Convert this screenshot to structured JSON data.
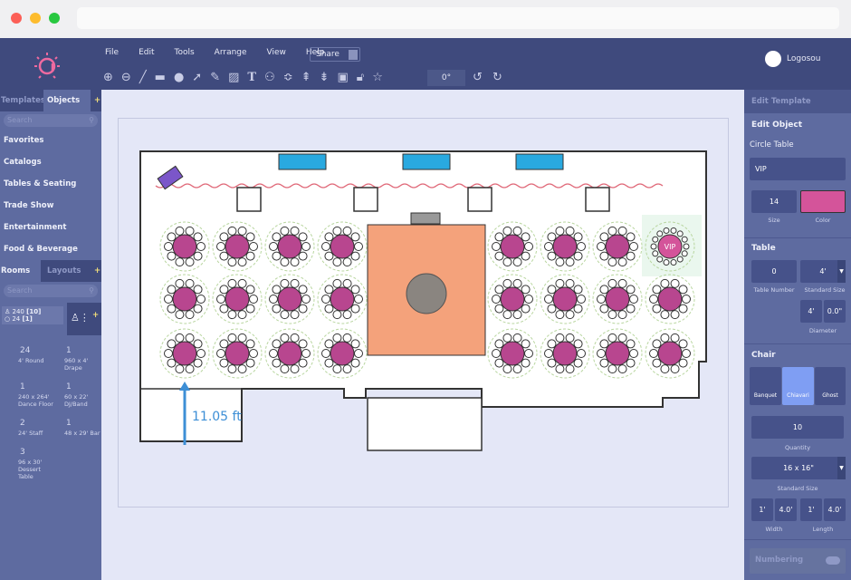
{
  "menu": {
    "items": [
      "File",
      "Edit",
      "Tools",
      "Arrange",
      "View",
      "Help"
    ],
    "share": "Share"
  },
  "toolbar": {
    "angle": "0°",
    "text_tool": "T"
  },
  "user": {
    "name": "Logosou"
  },
  "left": {
    "tabs": [
      "Templates",
      "Objects"
    ],
    "search_placeholder": "Search",
    "categories": [
      "Favorites",
      "Catalogs",
      "Tables & Seating",
      "Trade Show",
      "Entertainment",
      "Food & Beverage"
    ],
    "room_tabs": [
      "Rooms",
      "Layouts"
    ],
    "room_search_placeholder": "Search",
    "capacity": {
      "seats": "240",
      "seats_sub": "[10]",
      "tables": "24",
      "tables_sub": "[1]"
    },
    "stats": [
      {
        "count": "24",
        "label": "4' Round"
      },
      {
        "count": "1",
        "label": "960 x 4' Drape"
      },
      {
        "count": "1",
        "label": "240 x 264' Dance Floor"
      },
      {
        "count": "1",
        "label": "60 x 22' DJ/Band"
      },
      {
        "count": "2",
        "label": "24' Staff"
      },
      {
        "count": "1",
        "label": "48 x 29' Bar"
      },
      {
        "count": "3",
        "label": "96 x 30' Dessert Table"
      }
    ]
  },
  "plan": {
    "measurement": "11.05 ft",
    "vip_label": "VIP",
    "table_color": "#b8468f",
    "dance_floor_color": "#f4a27b",
    "stage_color": "#29a9e0"
  },
  "right": {
    "edit_template": "Edit Template",
    "edit_object": "Edit Object",
    "object_type": "Circle Table",
    "name_value": "VIP",
    "size": "14",
    "size_label": "Size",
    "color_label": "Color",
    "color": "#d4549a",
    "table_title": "Table",
    "table_number": "0",
    "table_number_label": "Table Number",
    "standard_size": "4'",
    "standard_size_label": "Standard Size",
    "diameter_ft": "4'",
    "diameter_in": "0.0\"",
    "diameter_label": "Diameter",
    "chair_title": "Chair",
    "chair_types": [
      "Banquet",
      "Chiavari",
      "Ghost"
    ],
    "quantity": "10",
    "quantity_label": "Quantity",
    "chair_size": "16 x 16\"",
    "chair_size_label": "Standard Size",
    "width_ft": "1'",
    "width_in": "4.0'",
    "length_ft": "1'",
    "length_in": "4.0'",
    "width_label": "Width",
    "length_label": "Length",
    "numbering": "Numbering"
  }
}
